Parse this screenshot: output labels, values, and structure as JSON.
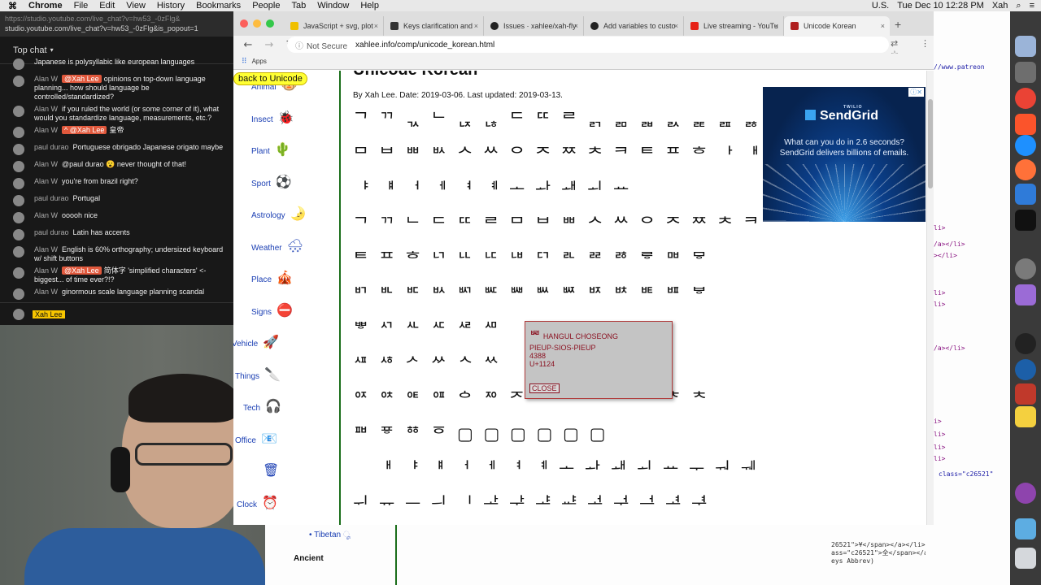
{
  "menubar": {
    "app": "Chrome",
    "items": [
      "File",
      "Edit",
      "View",
      "History",
      "Bookmarks",
      "People",
      "Tab",
      "Window",
      "Help"
    ],
    "status": {
      "input": "U.S.",
      "datetime": "Tue Dec 10  12:28 PM",
      "user": "Xah"
    }
  },
  "chat": {
    "popout_url_partial": "https://studio.youtube.com/live_chat?v=hw53_-0zFlg&",
    "popout_url": "studio.youtube.com/live_chat?v=hw53_-0zFlg&is_popout=1",
    "header": "Top chat",
    "messages": [
      {
        "author": "",
        "mention": "",
        "text": "Japanese is polysyllabic like european languages"
      },
      {
        "author": "Alan W",
        "mention": "@Xah Lee",
        "text": "opinions on top-down language planning... how should language be controlled/standardized?"
      },
      {
        "author": "Alan W",
        "mention": "",
        "text": "if you ruled the world (or some corner of it), what would you standardize language, measurements, etc.?"
      },
      {
        "author": "Alan W",
        "mention": "^ @Xah Lee",
        "text": "皇帝"
      },
      {
        "author": "paul durao",
        "mention": "",
        "text": "Portuguese obrigado Japanese origato maybe"
      },
      {
        "author": "Alan W",
        "mention": "",
        "text": "@paul durao 😮 never thought of that!"
      },
      {
        "author": "Alan W",
        "mention": "",
        "text": "you're from brazil right?"
      },
      {
        "author": "paul durao",
        "mention": "",
        "text": "Portugal"
      },
      {
        "author": "Alan W",
        "mention": "",
        "text": "ooooh nice"
      },
      {
        "author": "paul durao",
        "mention": "",
        "text": "Latin has accents"
      },
      {
        "author": "Alan W",
        "mention": "",
        "text": "English is 60% orthography; undersized keyboard w/ shift buttons"
      },
      {
        "author": "Alan W",
        "mention": "@Xah Lee",
        "text": "简体字 'simplified characters' <- biggest... of time ever?!?"
      },
      {
        "author": "Alan W",
        "mention": "",
        "text": "ginormous scale language planning scandal"
      }
    ],
    "self_name": "Xah Lee"
  },
  "browser": {
    "tabs": [
      {
        "label": "JavaScript + svg, plot",
        "icon_color": "#f0c000",
        "active": false
      },
      {
        "label": "Keys clarification and",
        "icon_color": "#333333",
        "active": false
      },
      {
        "label": "Issues · xahlee/xah-fly",
        "icon_color": "#222222",
        "active": false
      },
      {
        "label": "Add variables to custo",
        "icon_color": "#222222",
        "active": false
      },
      {
        "label": "Live streaming - YouTu",
        "icon_color": "#e62117",
        "active": false
      },
      {
        "label": "Unicode Korean",
        "icon_color": "#b02020",
        "active": true
      }
    ],
    "not_secure": "Not Secure",
    "url": "xahlee.info/comp/unicode_korean.html",
    "bookmarks": [
      {
        "label": "Apps"
      }
    ]
  },
  "page": {
    "back_button": "back to Unicode",
    "nav": [
      {
        "label": "Animal",
        "emoji": "🐵"
      },
      {
        "label": "Insect",
        "emoji": "🐞"
      },
      {
        "label": "Plant",
        "emoji": "🌵"
      },
      {
        "label": "Sport",
        "emoji": "⚽"
      },
      {
        "label": "Astrology",
        "emoji": "🌛"
      },
      {
        "label": "Weather",
        "emoji": "🌨"
      },
      {
        "label": "Place",
        "emoji": "🎪"
      },
      {
        "label": "Signs",
        "emoji": "⛔"
      },
      {
        "label": "Vehicle",
        "emoji": "🚀"
      },
      {
        "label": "Things",
        "emoji": "🔪"
      },
      {
        "label": "Tech",
        "emoji": "🎧"
      },
      {
        "label": "Office",
        "emoji": "📧"
      },
      {
        "label": "",
        "emoji": "🗑"
      },
      {
        "label": "Clock",
        "emoji": "⏰"
      }
    ],
    "title": "Unicode Korean",
    "byline": "By Xah Lee. Date: 2019-03-06. Last updated: 2019-03-13.",
    "hangul_rows": [
      "ᄀ ᄁ ᆪ ᄂ ᆬ ᆭ ᄃ ᄄ ᄅ ᆰ ᆱ ᆲ ᆳ ᆴ ᆵ ᆶ",
      "ᄆ ᄇ ᄈ ᄡ ᄉ ᄊ ᄋ ᄌ ᄍ ᄎ ᄏ ᄐ ᄑ ᄒ ᅡ ᅢ",
      "ᅣ ᅤ ᅥ ᅦ ᅧ ᅨ ᅩ ᅪ ᅫ ᅬ ᅭ",
      "ᄀ ᄁ ᄂ ᄃ ᄄ ᄅ ᄆ ᄇ ᄈ ᄉ ᄊ ᄋ ᄌ ᄍ ᄎ ᄏ",
      "ᄐ ᄑ ᄒ ᄓ ᄔ ᄕ ᄖ ᄗ ᄘ ᄙ ᄚ ᄛ ᄜ ᄝ",
      "ᄞ ᄟ ᄠ ᄡ ᄢ ᄣ ᄤ ᄥ ᄦ ᄧ ᄨ ᄩ ᄪ ᄫ",
      "ᄬ ᄭ ᄮ ᄯ ᄰ ᄱ",
      "ᄺ ᄻ ᄼ ᄽ ᄾ ᄿ",
      "ᅈ ᅉ ᅊ ᅋ ᅌ ᅍ ᅎ ᅏ ᅐ ᅑ ᅒ ᅓ ᅔ ᅕ",
      "ᅖ ᅗ ᅘ ᅙ ▢ ▢ ▢ ▢ ▢ ▢",
      "ᅟ ᅢ ᅣ ᅤ ᅥ ᅦ ᅧ ᅨ ᅩ ᅪ ᅫ ᅬ ᅭ ᅮ ᅯ ᅰ",
      "ᅱ ᅲ ᅳ ᅴ ᅵ ᅶ ᅷ ᅸ ᅹ ᅺ ᅻ ᅼ ᅽ ᅾ"
    ],
    "popup": {
      "glyph": "ᄤ",
      "name": "HANGUL CHOSEONG",
      "name2": "PIEUP-SIOS-PIEUP",
      "decimal": "4388",
      "codepoint": "U+1124",
      "close": "CLOSE"
    },
    "ad": {
      "brand_small": "TWILIO",
      "brand": "SendGrid",
      "line1": "What can you do in 2.6 seconds?",
      "line2": "SendGrid delivers billions of emails."
    }
  },
  "below_page": {
    "tibetan": "Tibetan",
    "ancient": "Ancient"
  },
  "devtools": {
    "url_snippet": "//www.patreon",
    "lines": [
      "li>",
      "/a></li>",
      "></li>",
      "li>",
      "li>",
      "/a></li>",
      "class=\"c26521\"",
      "i>",
      "li>",
      "li>",
      "li>"
    ],
    "bottom_lines": [
      "26521\">¥</span></a></li>",
      "ass=\"c26521\">全</span></a></li>",
      "eys Abbrev)"
    ]
  }
}
